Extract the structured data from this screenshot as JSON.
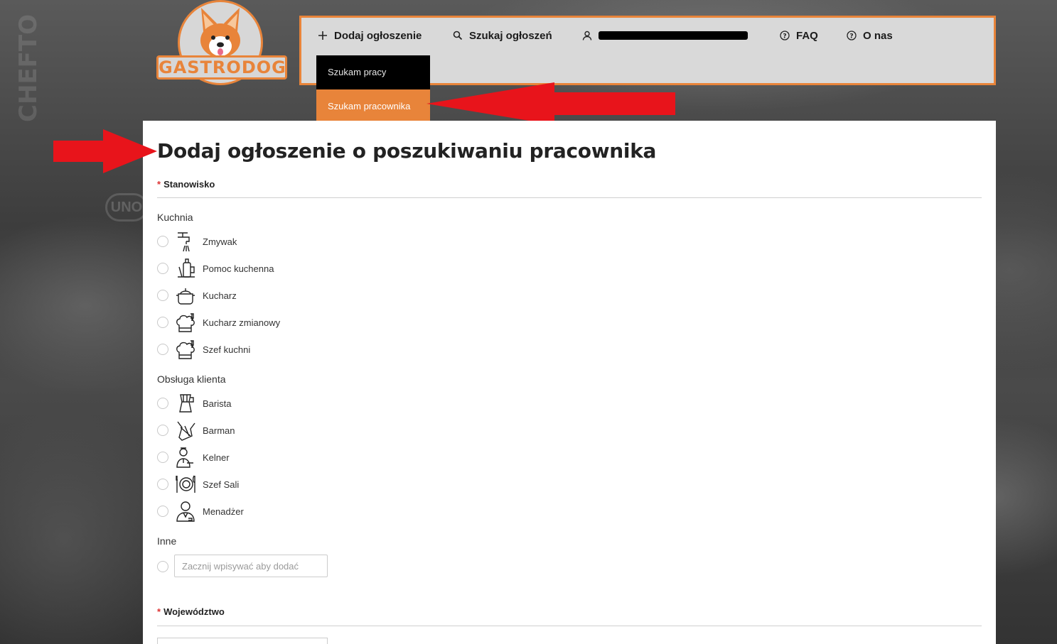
{
  "logo": {
    "text": "GASTRODOG"
  },
  "background": {
    "text": "CHEFTO",
    "brand": "UNO"
  },
  "nav": {
    "items": [
      {
        "label": "Dodaj ogłoszenie",
        "icon": "plus-icon"
      },
      {
        "label": "Szukaj ogłoszeń",
        "icon": "search-icon"
      },
      {
        "label": "",
        "icon": "user-icon"
      },
      {
        "label": "FAQ",
        "icon": "help-circle-icon"
      },
      {
        "label": "O nas",
        "icon": "help-circle-icon"
      }
    ]
  },
  "dropdown": {
    "items": [
      {
        "label": "Szukam pracy"
      },
      {
        "label": "Szukam pracownika"
      }
    ]
  },
  "form": {
    "title": "Dodaj ogłoszenie o poszukiwaniu pracownika",
    "stanowisko_label": "Stanowisko",
    "required_mark": "*",
    "groups": {
      "kuchnia": {
        "label": "Kuchnia",
        "options": [
          "Zmywak",
          "Pomoc kuchenna",
          "Kucharz",
          "Kucharz zmianowy",
          "Szef kuchni"
        ]
      },
      "obsluga": {
        "label": "Obsługa klienta",
        "options": [
          "Barista",
          "Barman",
          "Kelner",
          "Szef Sali",
          "Menadżer"
        ]
      },
      "inne": {
        "label": "Inne",
        "placeholder": "Zacznij wpisywać aby dodać"
      }
    },
    "wojewodztwo_label": "Województwo"
  },
  "colors": {
    "accent": "#e8843a",
    "nav_bg": "#d9d9d9",
    "arrow": "#e8141b"
  }
}
